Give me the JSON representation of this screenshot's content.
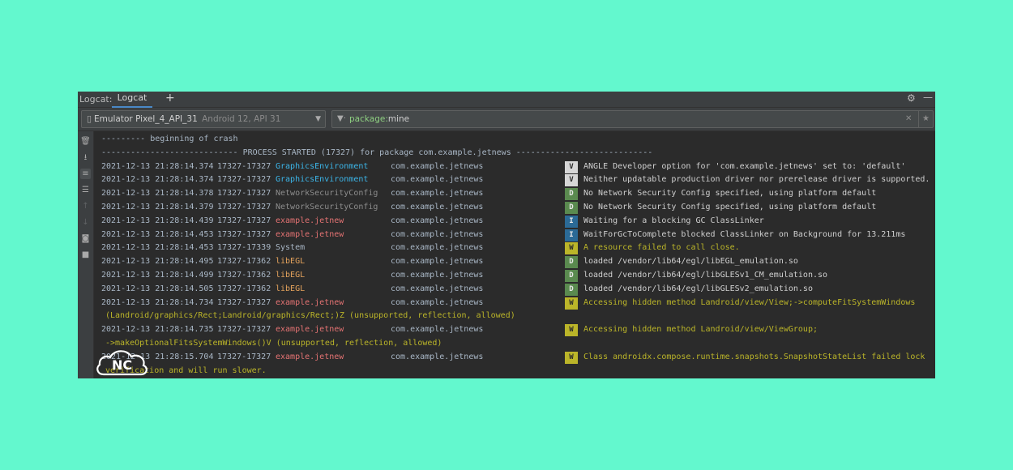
{
  "titlebar": {
    "label": "Logcat:",
    "tab": "Logcat",
    "plus": "+",
    "gear": "⚙",
    "minimize": "—"
  },
  "device": {
    "name": "Emulator Pixel_4_API_31",
    "api": "Android 12, API 31"
  },
  "filter": {
    "key": "package:",
    "value": "mine"
  },
  "sidebar_icons": [
    "trash-icon",
    "scroll-to-end-icon",
    "soft-wrap-icon",
    "settings-icon",
    "up-icon",
    "down-icon",
    "screenshot-icon",
    "screen-record-icon"
  ],
  "log": {
    "crash_line": "--------- beginning of crash",
    "process_line": "---------------------------- PROCESS STARTED (17327) for package com.example.jetnews ----------------------------",
    "entries": [
      {
        "dt": "2021-12-13 21:28:14.374",
        "pid": "17327-17327",
        "tag": "GraphicsEnvironment",
        "tag_color": "#3cb5e8",
        "pkg": "com.example.jetnews",
        "level": "V",
        "msg": "ANGLE Developer option for 'com.example.jetnews' set to: 'default'"
      },
      {
        "dt": "2021-12-13 21:28:14.374",
        "pid": "17327-17327",
        "tag": "GraphicsEnvironment",
        "tag_color": "#3cb5e8",
        "pkg": "com.example.jetnews",
        "level": "V",
        "msg": "Neither updatable production driver nor prerelease driver is supported."
      },
      {
        "dt": "2021-12-13 21:28:14.378",
        "pid": "17327-17327",
        "tag": "NetworkSecurityConfig",
        "tag_color": "#8c8c8c",
        "pkg": "com.example.jetnews",
        "level": "D",
        "msg": "No Network Security Config specified, using platform default"
      },
      {
        "dt": "2021-12-13 21:28:14.379",
        "pid": "17327-17327",
        "tag": "NetworkSecurityConfig",
        "tag_color": "#8c8c8c",
        "pkg": "com.example.jetnews",
        "level": "D",
        "msg": "No Network Security Config specified, using platform default"
      },
      {
        "dt": "2021-12-13 21:28:14.439",
        "pid": "17327-17327",
        "tag": "example.jetnew",
        "tag_color": "#e57373",
        "pkg": "com.example.jetnews",
        "level": "I",
        "msg": "Waiting for a blocking GC ClassLinker"
      },
      {
        "dt": "2021-12-13 21:28:14.453",
        "pid": "17327-17327",
        "tag": "example.jetnew",
        "tag_color": "#e57373",
        "pkg": "com.example.jetnews",
        "level": "I",
        "msg": "WaitForGcToComplete blocked ClassLinker on Background for 13.211ms"
      },
      {
        "dt": "2021-12-13 21:28:14.453",
        "pid": "17327-17339",
        "tag": "System",
        "tag_color": "#a9b7c6",
        "pkg": "com.example.jetnews",
        "level": "W",
        "msg": "A resource failed to call close."
      },
      {
        "dt": "2021-12-13 21:28:14.495",
        "pid": "17327-17362",
        "tag": "libEGL",
        "tag_color": "#e5a35c",
        "pkg": "com.example.jetnews",
        "level": "D",
        "msg": "loaded /vendor/lib64/egl/libEGL_emulation.so"
      },
      {
        "dt": "2021-12-13 21:28:14.499",
        "pid": "17327-17362",
        "tag": "libEGL",
        "tag_color": "#e5a35c",
        "pkg": "com.example.jetnews",
        "level": "D",
        "msg": "loaded /vendor/lib64/egl/libGLESv1_CM_emulation.so"
      },
      {
        "dt": "2021-12-13 21:28:14.505",
        "pid": "17327-17362",
        "tag": "libEGL",
        "tag_color": "#e5a35c",
        "pkg": "com.example.jetnews",
        "level": "D",
        "msg": "loaded /vendor/lib64/egl/libGLESv2_emulation.so"
      },
      {
        "dt": "2021-12-13 21:28:14.734",
        "pid": "17327-17327",
        "tag": "example.jetnew",
        "tag_color": "#e57373",
        "pkg": "com.example.jetnews",
        "level": "W",
        "msg": "Accessing hidden method Landroid/view/View;->computeFitSystemWindows",
        "cont": "(Landroid/graphics/Rect;Landroid/graphics/Rect;)Z (unsupported, reflection, allowed)"
      },
      {
        "dt": "2021-12-13 21:28:14.735",
        "pid": "17327-17327",
        "tag": "example.jetnew",
        "tag_color": "#e57373",
        "pkg": "com.example.jetnews",
        "level": "W",
        "msg": "Accessing hidden method Landroid/view/ViewGroup;",
        "cont": "->makeOptionalFitsSystemWindows()V (unsupported, reflection, allowed)"
      },
      {
        "dt": "2021-12-13 21:28:15.704",
        "pid": "17327-17327",
        "tag": "example.jetnew",
        "tag_color": "#e57373",
        "pkg": "com.example.jetnews",
        "level": "W",
        "msg": "Class androidx.compose.runtime.snapshots.SnapshotStateList failed lock",
        "cont": "verification and will run slower."
      }
    ]
  },
  "logo": {
    "text": "NC"
  }
}
